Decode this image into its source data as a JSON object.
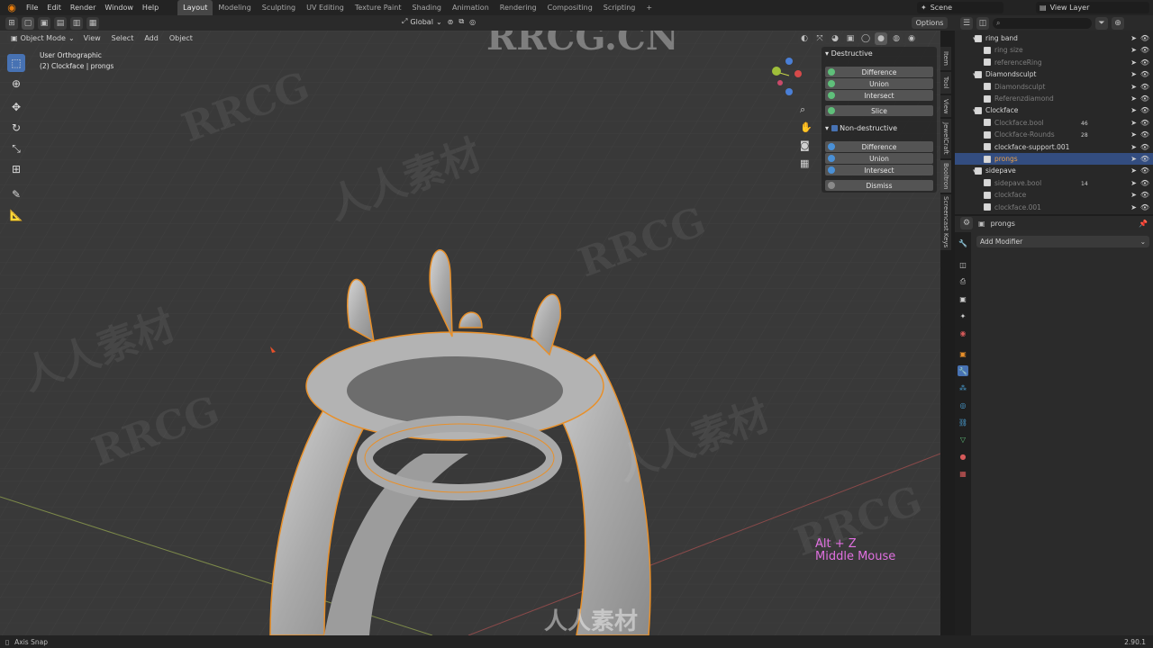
{
  "menu": [
    "File",
    "Edit",
    "Render",
    "Window",
    "Help"
  ],
  "workspaces": [
    "Layout",
    "Modeling",
    "Sculpting",
    "UV Editing",
    "Texture Paint",
    "Shading",
    "Animation",
    "Rendering",
    "Compositing",
    "Scripting"
  ],
  "active_workspace": "Layout",
  "scene_label": "Scene",
  "view_layer_label": "View Layer",
  "header": {
    "mode": "Object Mode",
    "items": [
      "View",
      "Select",
      "Add",
      "Object"
    ],
    "orientation": "Global",
    "options": "Options"
  },
  "viewport": {
    "view_name": "User Orthographic",
    "object_info": "(2) Clockface | prongs",
    "hotkey_line1": "Alt + Z",
    "hotkey_line2": "Middle Mouse",
    "watermark_top": "RRCG.CN",
    "watermark_bottom": "人人素材"
  },
  "boolean_panel": {
    "destructive_label": "Destructive",
    "destructive_buttons": [
      "Difference",
      "Union",
      "Intersect"
    ],
    "slice_label": "Slice",
    "nondestructive_label": "Non-destructive",
    "nondestructive_buttons": [
      "Difference",
      "Union",
      "Intersect"
    ],
    "dismiss_label": "Dismiss"
  },
  "side_tabs": [
    "Item",
    "Tool",
    "View",
    "JewelCraft",
    "Booltron",
    "Screencast Keys"
  ],
  "outliner": {
    "rows": [
      {
        "name": "ring band",
        "indent": 0,
        "dim": false,
        "selected": false
      },
      {
        "name": "ring size",
        "indent": 1,
        "dim": true,
        "selected": false
      },
      {
        "name": "referenceRing",
        "indent": 1,
        "dim": true,
        "selected": false
      },
      {
        "name": "Diamondsculpt",
        "indent": 0,
        "dim": false,
        "selected": false
      },
      {
        "name": "Diamondsculpt",
        "indent": 1,
        "dim": true,
        "selected": false
      },
      {
        "name": "Referenzdiamond",
        "indent": 1,
        "dim": true,
        "selected": false
      },
      {
        "name": "Clockface",
        "indent": 0,
        "dim": false,
        "selected": false
      },
      {
        "name": "Clockface.bool",
        "indent": 1,
        "dim": true,
        "selected": false
      },
      {
        "name": "Clockface-Rounds",
        "indent": 1,
        "dim": true,
        "selected": false
      },
      {
        "name": "clockface-support.001",
        "indent": 1,
        "dim": false,
        "selected": false
      },
      {
        "name": "prongs",
        "indent": 1,
        "dim": false,
        "selected": true
      },
      {
        "name": "sidepave",
        "indent": 0,
        "dim": false,
        "selected": false
      },
      {
        "name": "sidepave.bool",
        "indent": 1,
        "dim": true,
        "selected": false
      },
      {
        "name": "clockface",
        "indent": 1,
        "dim": true,
        "selected": false
      },
      {
        "name": "clockface.001",
        "indent": 1,
        "dim": true,
        "selected": false
      }
    ],
    "badges": {
      "clockface_bool": "46",
      "clockface_rounds": "28",
      "sidepave_bool": "14"
    }
  },
  "properties": {
    "object_name": "prongs",
    "add_modifier": "Add Modifier"
  },
  "status": {
    "left": "Axis Snap",
    "version": "2.90.1"
  },
  "colors": {
    "accent": "#4772b3",
    "selection_outline": "#e8902a",
    "hotkey_text": "#e070e0",
    "mesh": "#b9b9b9"
  }
}
